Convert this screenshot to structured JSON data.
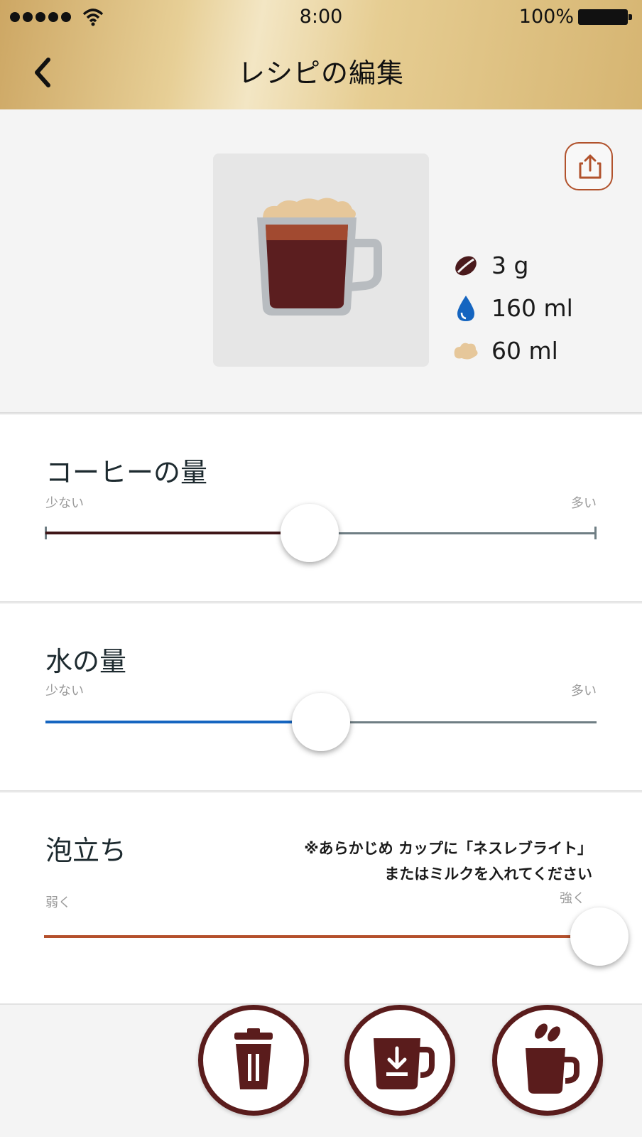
{
  "status_bar": {
    "time": "8:00",
    "battery": "100%"
  },
  "header": {
    "title": "レシピの編集"
  },
  "recipe": {
    "stats": [
      {
        "icon": "coffee-bean-icon",
        "value": "3 g"
      },
      {
        "icon": "water-drop-icon",
        "value": "160 ml"
      },
      {
        "icon": "foam-icon",
        "value": "60 ml"
      }
    ]
  },
  "sliders": {
    "coffee": {
      "title": "コーヒーの量",
      "min_label": "少ない",
      "max_label": "多い",
      "level": 0.48,
      "color": "#3f1517"
    },
    "water": {
      "title": "水の量",
      "min_label": "少ない",
      "max_label": "多い",
      "level": 0.5,
      "color": "#1565c0"
    },
    "foam": {
      "title": "泡立ち",
      "min_label": "弱く",
      "max_label": "強く",
      "level": 1.0,
      "color": "#b4502c",
      "note_line1": "※あらかじめ カップに「ネスレブライト」",
      "note_line2": "またはミルクを入れてください"
    }
  },
  "actions": [
    {
      "icon": "trash-icon"
    },
    {
      "icon": "save-cup-icon"
    },
    {
      "icon": "brew-cup-icon"
    }
  ],
  "colors": {
    "accent": "#5a1c1c",
    "share_border": "#b1522c",
    "header_gold": "#d6b572"
  }
}
